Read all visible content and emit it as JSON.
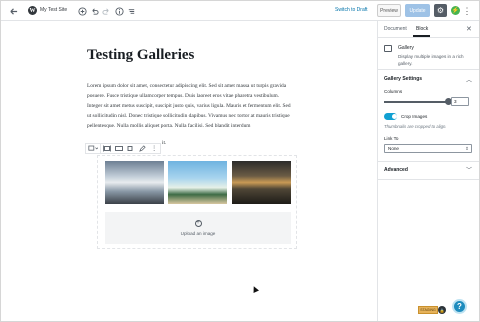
{
  "header": {
    "site_title": "My Test Site",
    "switch_to_draft": "Switch to Draft",
    "preview_label": "Preview",
    "publish_label": "Update",
    "settings_icon": "gear-icon",
    "more_icon": "more-vertical-icon"
  },
  "post": {
    "title": "Testing Galleries",
    "paragraph": "Lorem ipsum dolor sit amet, consectetur adipiscing elit. Sed sit amet massa ut turpis gravida posuere. Fusce tristique ullamcorper tempus. Duis laoreet eros vitae pharetra vestibulum. Integer sit amet metus suscipit, suscipit justo quis, varius ligula. Mauris et fermentum elit. Sed ut sollicitudin nisl. Donec tristique sollicitudin dapibus. Vivamus nec tortor at mauris tristique pellentesque. Nulla mollis aliquet porta. Nulla facilisi. Sed blandit interdum",
    "paragraph_tail": "it."
  },
  "gallery": {
    "images": [
      "cloudy-sky-image",
      "palm-beach-image",
      "sunset-silhouette-image"
    ],
    "upload_label": "Upload an image"
  },
  "sidebar": {
    "tab_document": "Document",
    "tab_block": "Block",
    "block_name": "Gallery",
    "block_description": "Display multiple images in a rich gallery.",
    "settings_title": "Gallery Settings",
    "columns_label": "Columns",
    "columns_value": "3",
    "columns_fraction": 1.0,
    "crop_label": "Crop Images",
    "crop_enabled": true,
    "crop_help": "Thumbnails are cropped to align.",
    "link_to_label": "Link To",
    "link_to_value": "None",
    "advanced_title": "Advanced"
  },
  "footer": {
    "badge_text": "STAGING",
    "help_label": "?"
  },
  "colors": {
    "accent": "#0073aa",
    "toggle": "#11a0d2",
    "publish_disabled": "#9ec2e6",
    "help": "#1e8cbe"
  }
}
